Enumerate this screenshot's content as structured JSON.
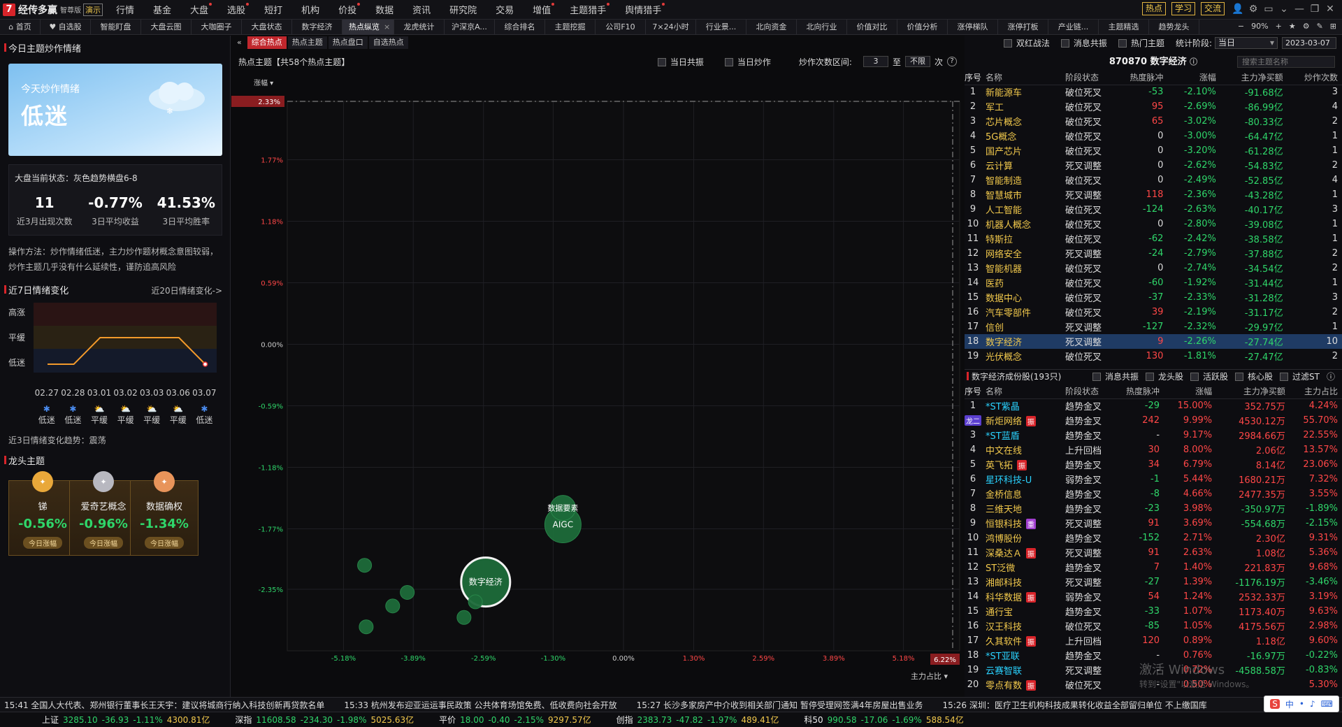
{
  "app": {
    "brand_mark": "7",
    "name": "经传多赢",
    "edition": "智尊版",
    "version_badge": "演示"
  },
  "menu": [
    {
      "label": "行情",
      "dot": false
    },
    {
      "label": "基金",
      "dot": false
    },
    {
      "label": "大盘",
      "dot": true
    },
    {
      "label": "选股",
      "dot": true
    },
    {
      "label": "短打",
      "dot": false
    },
    {
      "label": "机构",
      "dot": false
    },
    {
      "label": "价投",
      "dot": true
    },
    {
      "label": "数据",
      "dot": false
    },
    {
      "label": "资讯",
      "dot": false
    },
    {
      "label": "研究院",
      "dot": false
    },
    {
      "label": "交易",
      "dot": false
    },
    {
      "label": "增值",
      "dot": true
    },
    {
      "label": "主题猎手",
      "dot": true
    },
    {
      "label": "舆情猎手",
      "dot": true
    }
  ],
  "top_buttons": [
    "热点",
    "学习",
    "交流"
  ],
  "window_icons": [
    "user-icon",
    "gear-icon",
    "layout-icon",
    "chevron-down-icon",
    "minimize-icon",
    "maximize-icon",
    "close-icon"
  ],
  "tabs": [
    {
      "label": "⌂ 首页",
      "w": 58
    },
    {
      "label": "♥ 自选股",
      "w": 72
    },
    {
      "label": "智能盯盘",
      "w": 72
    },
    {
      "label": "大盘云图",
      "w": 72
    },
    {
      "label": "大咖圈子",
      "w": 72
    },
    {
      "label": "大盘状态",
      "w": 72
    },
    {
      "label": "数字经济",
      "w": 72
    },
    {
      "label": "热点纵览",
      "w": 74,
      "active": true,
      "closable": true
    },
    {
      "label": "龙虎统计",
      "w": 72
    },
    {
      "label": "沪深京A...",
      "w": 72
    },
    {
      "label": "综合排名",
      "w": 72
    },
    {
      "label": "主题挖掘",
      "w": 72
    },
    {
      "label": "公司F10",
      "w": 72
    },
    {
      "label": "7×24小时",
      "w": 72
    },
    {
      "label": "行业景...",
      "w": 72
    },
    {
      "label": "北向资金",
      "w": 72
    },
    {
      "label": "北向行业",
      "w": 72
    },
    {
      "label": "价值对比",
      "w": 72
    },
    {
      "label": "价值分析",
      "w": 72
    },
    {
      "label": "涨停梯队",
      "w": 72
    },
    {
      "label": "涨停打板",
      "w": 72
    },
    {
      "label": "产业链...",
      "w": 72
    },
    {
      "label": "主题精选",
      "w": 72
    },
    {
      "label": "趋势龙头",
      "w": 72
    }
  ],
  "zoom": {
    "minus": "−",
    "value": "90%",
    "plus": "+"
  },
  "left": {
    "title": "今日主题炒作情绪",
    "mood_label": "今天炒作情绪",
    "mood_value": "低迷",
    "status_label": "大盘当前状态：灰色趋势横盘6-8",
    "stats": [
      {
        "value": "11",
        "label": "近3月出现次数"
      },
      {
        "value": "-0.77%",
        "label": "3日平均收益"
      },
      {
        "value": "41.53%",
        "label": "3日平均胜率"
      }
    ],
    "desc": "操作方法：炒作情绪低迷，主力炒作题材概念意图较弱，炒作主题几乎没有什么延续性，谨防追高风险",
    "seven_title": "近7日情绪变化",
    "seven_more": "近20日情绪变化->",
    "levels": [
      "高涨",
      "平缓",
      "低迷"
    ],
    "dates": [
      "02.27",
      "02.28",
      "03.01",
      "03.02",
      "03.03",
      "03.06",
      "03.07"
    ],
    "day_moods": [
      {
        "label": "低迷",
        "icon": "snow-icon",
        "level": 0
      },
      {
        "label": "低迷",
        "icon": "snow-icon",
        "level": 0
      },
      {
        "label": "平缓",
        "icon": "sun-cloud-icon",
        "level": 1
      },
      {
        "label": "平缓",
        "icon": "sun-cloud-icon",
        "level": 1
      },
      {
        "label": "平缓",
        "icon": "sun-cloud-icon",
        "level": 1
      },
      {
        "label": "平缓",
        "icon": "sun-cloud-icon",
        "level": 1
      },
      {
        "label": "低迷",
        "icon": "snow-icon",
        "level": 0
      }
    ],
    "trend3": "近3日情绪变化趋势：震荡",
    "leaders_title": "龙头主题",
    "leaders": [
      {
        "name": "锑",
        "pct": "-0.56%",
        "badge": "今日涨幅",
        "medal": "gold"
      },
      {
        "name": "爱奇艺概念",
        "pct": "-0.96%",
        "badge": "今日涨幅",
        "medal": "silver"
      },
      {
        "name": "数据确权",
        "pct": "-1.34%",
        "badge": "今日涨幅",
        "medal": "bronze"
      }
    ]
  },
  "mid": {
    "subtabs": [
      "综合热点",
      "热点主题",
      "热点盘口",
      "自选热点"
    ],
    "title": "热点主题【共58个热点主题】",
    "chk1": "当日共振",
    "chk2": "当日炒作",
    "range_label": "炒作次数区间:",
    "range_from": "3",
    "range_to_label": "至",
    "range_to": "不限",
    "range_unit": "次",
    "y_axis_title": "涨幅 ▾",
    "x_axis_title": "主力占比 ▾"
  },
  "chart_data": {
    "type": "scatter",
    "xlabel": "主力占比",
    "ylabel": "涨幅",
    "x_ticks": [
      "-5.18%",
      "-3.89%",
      "-2.59%",
      "-1.30%",
      "0.00%",
      "1.30%",
      "2.59%",
      "3.89%",
      "5.18%"
    ],
    "x_tick_values": [
      -5.18,
      -3.89,
      -2.59,
      -1.3,
      0.0,
      1.3,
      2.59,
      3.89,
      5.18
    ],
    "y_ticks": [
      "1.77%",
      "1.18%",
      "0.59%",
      "0.00%",
      "-0.59%",
      "-1.18%",
      "-1.77%",
      "-2.35%"
    ],
    "y_tick_values": [
      1.77,
      1.18,
      0.59,
      0.0,
      -0.59,
      -1.18,
      -1.77,
      -2.35
    ],
    "xlim": [
      -6.22,
      6.22
    ],
    "ylim": [
      -2.94,
      2.33
    ],
    "x_max_label": "6.22%",
    "y_max_label": "2.33%",
    "points": [
      {
        "x": -2.55,
        "y": -2.28,
        "label": "数字经济",
        "size": "large",
        "highlight": true
      },
      {
        "x": -1.12,
        "y": -1.73,
        "label": "AIGC",
        "size": "medium"
      },
      {
        "x": -1.12,
        "y": -1.57,
        "label": "数据要素",
        "size": "small"
      },
      {
        "x": -2.74,
        "y": -2.47,
        "label": "",
        "size": "tiny"
      },
      {
        "x": -2.95,
        "y": -2.62,
        "label": "",
        "size": "tiny"
      },
      {
        "x": -4.79,
        "y": -2.12,
        "label": "",
        "size": "tiny"
      },
      {
        "x": -4.27,
        "y": -2.51,
        "label": "",
        "size": "tiny"
      },
      {
        "x": -4.76,
        "y": -2.71,
        "label": "",
        "size": "tiny"
      },
      {
        "x": -4.0,
        "y": -2.38,
        "label": "",
        "size": "tiny"
      }
    ]
  },
  "right": {
    "ctrl": {
      "chk1": "双红战法",
      "chk2": "消息共振",
      "chk3": "热门主题",
      "stage_label": "统计阶段:",
      "stage_value": "当日",
      "date": "2023-03-07"
    },
    "header": "870870 数字经济",
    "search_placeholder": "搜索主题名称",
    "top_cols": [
      "序号",
      "名称",
      "阶段状态",
      "热度脉冲",
      "涨幅",
      "主力净买额",
      "炒作次数"
    ],
    "top_rows": [
      [
        "1",
        "新能源车",
        "破位死叉",
        "-53",
        "-2.10%",
        "-91.68亿",
        "3"
      ],
      [
        "2",
        "军工",
        "破位死叉",
        "95",
        "-2.69%",
        "-86.99亿",
        "4"
      ],
      [
        "3",
        "芯片概念",
        "破位死叉",
        "65",
        "-3.02%",
        "-80.33亿",
        "2"
      ],
      [
        "4",
        "5G概念",
        "破位死叉",
        "0",
        "-3.00%",
        "-64.47亿",
        "1"
      ],
      [
        "5",
        "国产芯片",
        "破位死叉",
        "0",
        "-3.20%",
        "-61.28亿",
        "1"
      ],
      [
        "6",
        "云计算",
        "死叉调整",
        "0",
        "-2.62%",
        "-54.83亿",
        "2"
      ],
      [
        "7",
        "智能制造",
        "破位死叉",
        "0",
        "-2.49%",
        "-52.85亿",
        "4"
      ],
      [
        "8",
        "智慧城市",
        "死叉调整",
        "118",
        "-2.36%",
        "-43.28亿",
        "1"
      ],
      [
        "9",
        "人工智能",
        "破位死叉",
        "-124",
        "-2.63%",
        "-40.17亿",
        "3"
      ],
      [
        "10",
        "机器人概念",
        "破位死叉",
        "0",
        "-2.80%",
        "-39.08亿",
        "1"
      ],
      [
        "11",
        "特斯拉",
        "破位死叉",
        "-62",
        "-2.42%",
        "-38.58亿",
        "1"
      ],
      [
        "12",
        "网络安全",
        "死叉调整",
        "-24",
        "-2.79%",
        "-37.88亿",
        "2"
      ],
      [
        "13",
        "智能机器",
        "破位死叉",
        "0",
        "-2.74%",
        "-34.54亿",
        "2"
      ],
      [
        "14",
        "医药",
        "破位死叉",
        "-60",
        "-1.92%",
        "-31.44亿",
        "1"
      ],
      [
        "15",
        "数据中心",
        "破位死叉",
        "-37",
        "-2.33%",
        "-31.28亿",
        "3"
      ],
      [
        "16",
        "汽车零部件",
        "破位死叉",
        "39",
        "-2.19%",
        "-31.17亿",
        "2"
      ],
      [
        "17",
        "信创",
        "死叉调整",
        "-127",
        "-2.32%",
        "-29.97亿",
        "1"
      ],
      [
        "18",
        "数字经济",
        "死叉调整",
        "9",
        "-2.26%",
        "-27.74亿",
        "10"
      ],
      [
        "19",
        "光伏概念",
        "破位死叉",
        "130",
        "-1.81%",
        "-27.47亿",
        "2"
      ]
    ],
    "selected_index": 17,
    "sub_title": "数字经济成份股(193只)",
    "sub_opts": [
      "消息共振",
      "龙头股",
      "活跃股",
      "核心股",
      "过滤ST"
    ],
    "sub_cols": [
      "序号",
      "名称",
      "阶段状态",
      "热度脉冲",
      "涨幅",
      "主力净买额",
      "主力占比"
    ],
    "sub_rows": [
      [
        "1",
        "*ST紫晶",
        "",
        "趋势金叉",
        "-29",
        "15.00%",
        "352.75万",
        "4.24%"
      ],
      [
        "龙二",
        "新炬网络",
        "振",
        "趋势金叉",
        "242",
        "9.99%",
        "4530.12万",
        "55.70%"
      ],
      [
        "3",
        "*ST蓝盾",
        "",
        "趋势金叉",
        "-",
        "9.17%",
        "2984.66万",
        "22.55%"
      ],
      [
        "4",
        "中文在线",
        "",
        "上升回档",
        "30",
        "8.00%",
        "2.06亿",
        "13.57%"
      ],
      [
        "5",
        "英飞拓",
        "振",
        "趋势金叉",
        "34",
        "6.79%",
        "8.14亿",
        "23.06%"
      ],
      [
        "6",
        "星环科技-U",
        "",
        "弱势金叉",
        "-1",
        "5.44%",
        "1680.21万",
        "7.32%"
      ],
      [
        "7",
        "金桥信息",
        "",
        "趋势金叉",
        "-8",
        "4.66%",
        "2477.35万",
        "3.55%"
      ],
      [
        "8",
        "三维天地",
        "",
        "趋势金叉",
        "-23",
        "3.98%",
        "-350.97万",
        "-1.89%"
      ],
      [
        "9",
        "恒银科技",
        "重",
        "死叉调整",
        "91",
        "3.69%",
        "-554.68万",
        "-2.15%"
      ],
      [
        "10",
        "鸿博股份",
        "",
        "趋势金叉",
        "-152",
        "2.71%",
        "2.30亿",
        "9.31%"
      ],
      [
        "11",
        "深桑达Ａ",
        "振",
        "死叉调整",
        "91",
        "2.63%",
        "1.08亿",
        "5.36%"
      ],
      [
        "12",
        "ST泛微",
        "",
        "趋势金叉",
        "7",
        "1.40%",
        "221.83万",
        "9.68%"
      ],
      [
        "13",
        "湘邮科技",
        "",
        "死叉调整",
        "-27",
        "1.39%",
        "-1176.19万",
        "-3.46%"
      ],
      [
        "14",
        "科华数据",
        "振",
        "弱势金叉",
        "54",
        "1.24%",
        "2532.33万",
        "3.19%"
      ],
      [
        "15",
        "通行宝",
        "",
        "趋势金叉",
        "-33",
        "1.07%",
        "1173.40万",
        "9.63%"
      ],
      [
        "16",
        "汉王科技",
        "",
        "破位死叉",
        "-85",
        "1.05%",
        "4175.56万",
        "2.98%"
      ],
      [
        "17",
        "久其软件",
        "振",
        "上升回档",
        "120",
        "0.89%",
        "1.18亿",
        "9.60%"
      ],
      [
        "18",
        "*ST亚联",
        "",
        "趋势金叉",
        "-",
        "0.76%",
        "-16.97万",
        "-0.22%"
      ],
      [
        "19",
        "云赛智联",
        "",
        "死叉调整",
        "-",
        "0.72%",
        "-4588.58万",
        "-0.83%"
      ],
      [
        "20",
        "零点有数",
        "振",
        "破位死叉",
        "-",
        "0.50%",
        "",
        "5.30%"
      ]
    ]
  },
  "news": [
    "15:41 全国人大代表、郑州银行董事长王天宇：建议将城商行纳入科技创新再贷款名单",
    "15:33 杭州发布迎亚运运事民政策 公共体育场馆免费、低收费向社会开放",
    "15:27 长沙多家房产中介收到相关部门通知 暂停受理网签满4年房屋出售业务",
    "15:26 深圳：医疗卫生机构科技成果转化收益全部留归单位 不上缴国库"
  ],
  "indices": [
    {
      "name": "上证",
      "v": "3285.10",
      "chg": "-36.93",
      "pct": "-1.11%",
      "amt": "4300.81亿"
    },
    {
      "name": "深指",
      "v": "11608.58",
      "chg": "-234.30",
      "pct": "-1.98%",
      "amt": "5025.63亿"
    },
    {
      "name": "平价",
      "v": "18.00",
      "chg": "-0.40",
      "pct": "-2.15%",
      "amt": "9297.57亿"
    },
    {
      "name": "创指",
      "v": "2383.73",
      "chg": "-47.82",
      "pct": "-1.97%",
      "amt": "489.41亿"
    },
    {
      "name": "科50",
      "v": "990.58",
      "chg": "-17.06",
      "pct": "-1.69%",
      "amt": "588.54亿"
    }
  ],
  "watermark": {
    "line1": "激活 Windows",
    "line2": "转到\"设置\"以激活 Windows。"
  },
  "tray": [
    "中",
    "•",
    "♪",
    "⌨"
  ],
  "colors": {
    "up": "#ff4747",
    "down": "#2fd66a",
    "accent": "#c1272d",
    "select": "#1f3b64"
  }
}
